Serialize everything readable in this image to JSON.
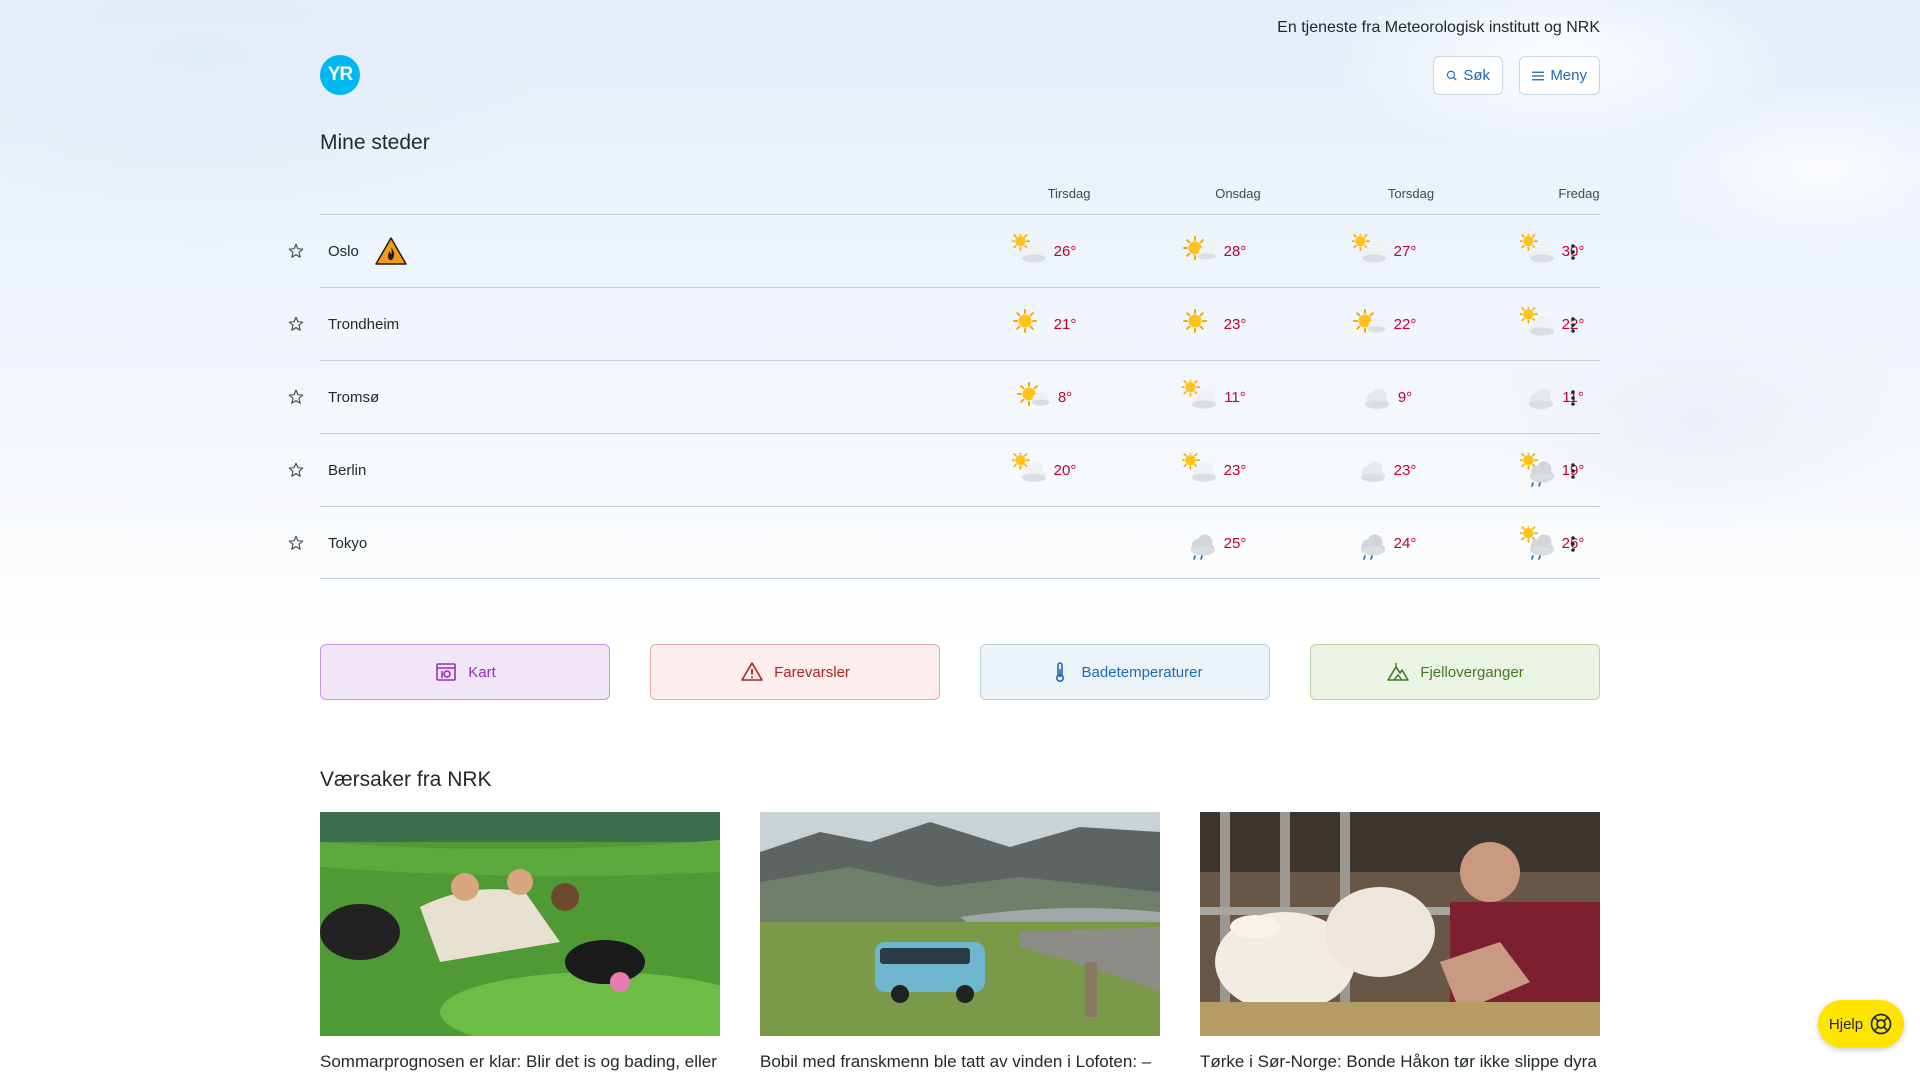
{
  "header": {
    "tagline": "En tjeneste fra Meteorologisk institutt og NRK",
    "logo_text": "YR",
    "search_label": "Søk",
    "menu_label": "Meny"
  },
  "places": {
    "title": "Mine steder",
    "days": [
      "Tirsdag",
      "Onsdag",
      "Torsdag",
      "Fredag"
    ],
    "rows": [
      {
        "name": "Oslo",
        "warning": "fire-danger-icon",
        "forecast": [
          {
            "icon": "partly-cloudy-icon",
            "temp": "26°"
          },
          {
            "icon": "sun-cloud-icon",
            "temp": "28°"
          },
          {
            "icon": "partly-cloudy-icon",
            "temp": "27°"
          },
          {
            "icon": "partly-cloudy-icon",
            "temp": "30°"
          }
        ]
      },
      {
        "name": "Trondheim",
        "forecast": [
          {
            "icon": "sun-icon",
            "temp": "21°"
          },
          {
            "icon": "sun-icon",
            "temp": "23°"
          },
          {
            "icon": "sun-cloud-icon",
            "temp": "22°"
          },
          {
            "icon": "partly-cloudy-icon",
            "temp": "22°"
          }
        ]
      },
      {
        "name": "Tromsø",
        "forecast": [
          {
            "icon": "sun-cloud-icon",
            "temp": "8°"
          },
          {
            "icon": "partly-cloudy-icon",
            "temp": "11°"
          },
          {
            "icon": "cloud-icon",
            "temp": "9°"
          },
          {
            "icon": "cloud-icon",
            "temp": "11°"
          }
        ]
      },
      {
        "name": "Berlin",
        "forecast": [
          {
            "icon": "partly-cloudy-icon",
            "temp": "20°"
          },
          {
            "icon": "partly-cloudy-icon",
            "temp": "23°"
          },
          {
            "icon": "cloud-icon",
            "temp": "23°"
          },
          {
            "icon": "sun-rain-icon",
            "temp": "19°"
          }
        ]
      },
      {
        "name": "Tokyo",
        "forecast": [
          null,
          {
            "icon": "rain-cloud-icon",
            "temp": "25°"
          },
          {
            "icon": "rain-cloud-icon",
            "temp": "24°"
          },
          {
            "icon": "sun-rain-icon",
            "temp": "26°"
          }
        ]
      }
    ]
  },
  "quicklinks": {
    "kart": "Kart",
    "farevarsler": "Farevarsler",
    "badetemperaturer": "Badetemperaturer",
    "fjelloverganger": "Fjelloverganger"
  },
  "news": {
    "title": "Værsaker fra NRK",
    "articles": [
      {
        "title": "Sommarprognosen er klar: Blir det is og bading, eller"
      },
      {
        "title": "Bobil med franskmenn ble tatt av vinden i Lofoten: –"
      },
      {
        "title": "Tørke i Sør-Norge: Bonde Håkon tør ikke slippe dyra"
      }
    ]
  },
  "help": {
    "label": "Hjelp"
  },
  "colors": {
    "temp_warm": "#c3002f",
    "link_blue": "#1f6ab7",
    "logo": "#00b8f1",
    "help": "#ffe400"
  }
}
